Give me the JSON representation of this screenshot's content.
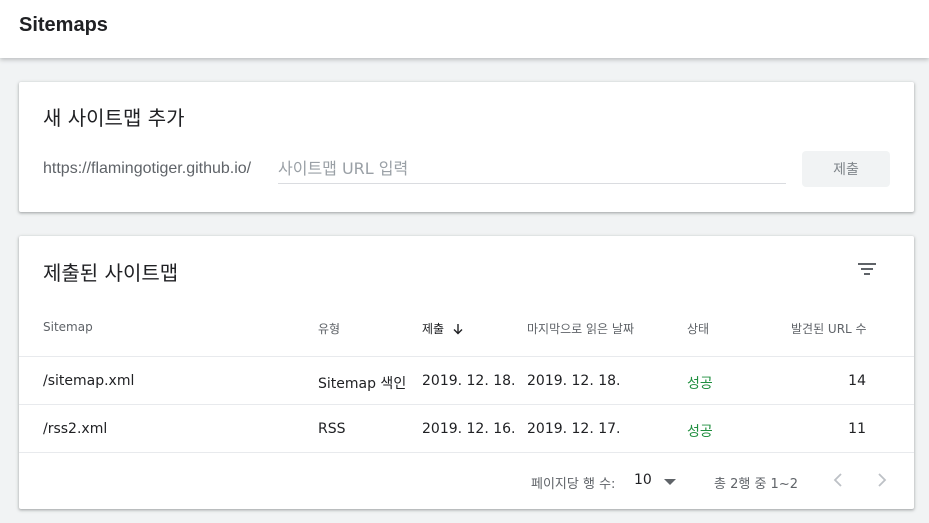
{
  "header": {
    "title": "Sitemaps"
  },
  "add_card": {
    "title": "새 사이트맵 추가",
    "url_prefix": "https://flamingotiger.github.io/",
    "input_placeholder": "사이트맵 URL 입력",
    "submit_label": "제출"
  },
  "list_card": {
    "title": "제출된 사이트맵",
    "filter_icon": "filter-icon",
    "columns": [
      "Sitemap",
      "유형",
      "제출",
      "마지막으로 읽은 날짜",
      "상태",
      "발견된 URL 수"
    ],
    "sorted_column": "제출",
    "sort_icon": "arrow-down-icon",
    "rows": [
      {
        "sitemap": "/sitemap.xml",
        "type": "Sitemap 색인",
        "submitted": "2019. 12. 18.",
        "last_read": "2019. 12. 18.",
        "status": "성공",
        "urls": "14"
      },
      {
        "sitemap": "/rss2.xml",
        "type": "RSS",
        "submitted": "2019. 12. 16.",
        "last_read": "2019. 12. 17.",
        "status": "성공",
        "urls": "11"
      }
    ],
    "pagination": {
      "rows_per_page_label": "페이지당 행 수:",
      "rows_per_page_value": "10",
      "range_text": "총 2행 중 1~2"
    }
  },
  "colors": {
    "status_success": "#1e8e3e",
    "text_primary": "#202124",
    "text_secondary": "#5f6368"
  }
}
